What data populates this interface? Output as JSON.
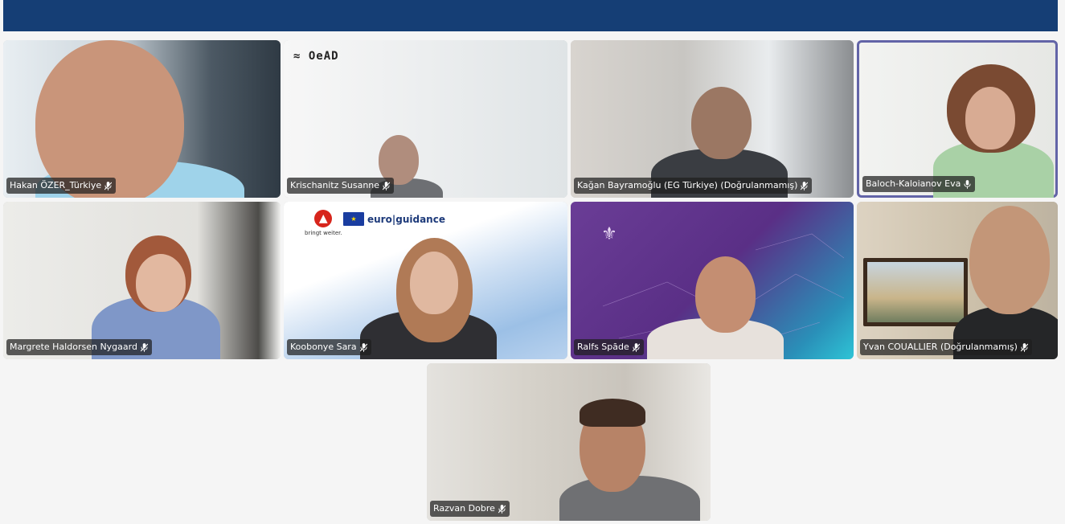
{
  "header": {
    "color": "#153e75"
  },
  "colors": {
    "active_speaker_outline": "#6264a7"
  },
  "participants": [
    {
      "name": "Hakan ÖZER_Türkiye",
      "mic": "muted-mic-icon"
    },
    {
      "name": "Krischanitz Susanne",
      "mic": "muted-mic-icon",
      "logo": "≈ OeAD"
    },
    {
      "name": "Kağan Bayramoğlu (EG Türkiye) (Doğrulanmamış)",
      "mic": "muted-mic-icon"
    },
    {
      "name": "Baloch-Kaloianov Eva",
      "mic": "mic-icon",
      "active": true
    },
    {
      "name": "Margrete Haldorsen Nygaard",
      "mic": "muted-mic-icon"
    },
    {
      "name": "Koobonye Sara",
      "mic": "muted-mic-icon",
      "logo_text": "bringt weiter.",
      "brand": "euro|guidance"
    },
    {
      "name": "Ralfs Spāde",
      "mic": "muted-mic-icon"
    },
    {
      "name": "Yvan COUALLIER (Doğrulanmamış)",
      "mic": "muted-mic-icon"
    },
    {
      "name": "Razvan Dobre",
      "mic": "muted-mic-icon"
    }
  ]
}
